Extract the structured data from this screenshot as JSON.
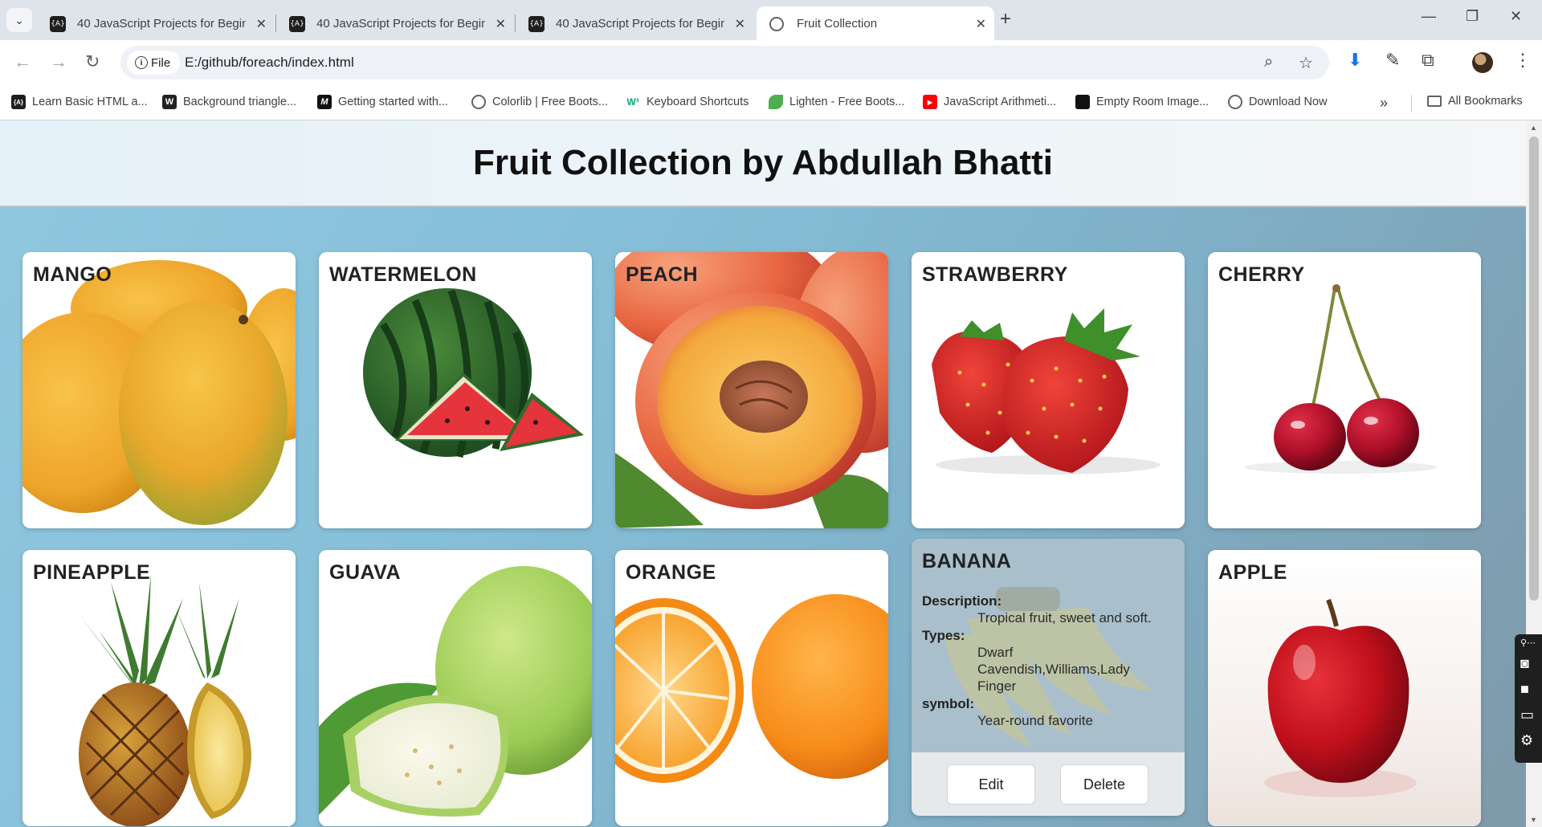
{
  "browser": {
    "tabs": [
      {
        "title": "40 JavaScript Projects for Beginners",
        "active": false
      },
      {
        "title": "40 JavaScript Projects for Beginners",
        "active": false
      },
      {
        "title": "40 JavaScript Projects for Beginners",
        "active": false
      },
      {
        "title": "Fruit Collection",
        "active": true
      }
    ],
    "site_chip": "File",
    "url": "E:/github/foreach/index.html",
    "bookmarks": [
      {
        "label": "Learn Basic HTML a...",
        "icon": "codecademy-icon"
      },
      {
        "label": "Background triangle...",
        "icon": "w-icon"
      },
      {
        "label": "Getting started with...",
        "icon": "m-icon"
      },
      {
        "label": "Colorlib | Free Boots...",
        "icon": "globe-icon"
      },
      {
        "label": "Keyboard Shortcuts",
        "icon": "w3-icon"
      },
      {
        "label": "Lighten - Free Boots...",
        "icon": "leaf-icon"
      },
      {
        "label": "JavaScript Arithmeti...",
        "icon": "youtube-icon"
      },
      {
        "label": "Empty Room Image...",
        "icon": "image-icon"
      },
      {
        "label": "Download Now",
        "icon": "globe-icon"
      }
    ],
    "all_bookmarks": "All Bookmarks"
  },
  "page": {
    "title": "Fruit Collection by Abdullah Bhatti",
    "fruits": [
      {
        "name": "MANGO"
      },
      {
        "name": "WATERMELON"
      },
      {
        "name": "PEACH"
      },
      {
        "name": "STRAWBERRY"
      },
      {
        "name": "CHERRY"
      },
      {
        "name": "PINEAPPLE"
      },
      {
        "name": "GUAVA"
      },
      {
        "name": "ORANGE"
      },
      {
        "name": "BANANA",
        "description_label": "Description:",
        "description": "Tropical fruit, sweet and soft.",
        "types_label": "Types:",
        "types": "Dwarf Cavendish,Williams,Lady Finger",
        "symbol_label": "symbol:",
        "symbol": "Year-round favorite",
        "edit_label": "Edit",
        "delete_label": "Delete"
      },
      {
        "name": "APPLE"
      }
    ]
  }
}
